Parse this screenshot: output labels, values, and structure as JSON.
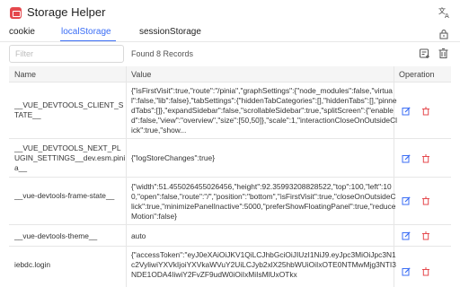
{
  "app": {
    "title": "Storage Helper"
  },
  "tabs": [
    {
      "label": "cookie"
    },
    {
      "label": "localStorage"
    },
    {
      "label": "sessionStorage"
    }
  ],
  "filter": {
    "placeholder": "Filter",
    "value": ""
  },
  "found_text": "Found 8 Records",
  "columns": {
    "name": "Name",
    "value": "Value",
    "operation": "Operation"
  },
  "rows": [
    {
      "name": "__VUE_DEVTOOLS_CLIENT_STATE__",
      "value": "{\"isFirstVisit\":true,\"route\":\"/pinia\",\"graphSettings\":{\"node_modules\":false,\"virtual\":false,\"lib\":false},\"tabSettings\":{\"hiddenTabCategories\":[],\"hiddenTabs\":[],\"pinnedTabs\":[]},\"expandSidebar\":false,\"scrollableSidebar\":true,\"splitScreen\":{\"enabled\":false,\"view\":\"overview\",\"size\":[50,50]},\"scale\":1,\"interactionCloseOnOutsideClick\":true,\"show..."
    },
    {
      "name": "__VUE_DEVTOOLS_NEXT_PLUGIN_SETTINGS__dev.esm.pinia__",
      "value": "{\"logStoreChanges\":true}"
    },
    {
      "name": "__vue-devtools-frame-state__",
      "value": "{\"width\":51.455026455026456,\"height\":92.35993208828522,\"top\":100,\"left\":100,\"open\":false,\"route\":\"/\",\"position\":\"bottom\",\"isFirstVisit\":true,\"closeOnOutsideClick\":true,\"minimizePanelInactive\":5000,\"preferShowFloatingPanel\":true,\"reduceMotion\":false}"
    },
    {
      "name": "__vue-devtools-theme__",
      "value": "auto"
    },
    {
      "name": "iebdc.login",
      "value": "{\"accessToken\":\"eyJ0eXAiOiJKV1QiLCJhbGciOiJIUzI1NiJ9.eyJpc3MiOiJpc3N1c2VyliwiYXVkIjoiYXVkaWVuY2UiLCJyb2xlX25hbWUiOiIxOTE0NTMwMjg3NTI3NDE1ODA4IiwiY2FvZF9udW0iOiIxMiIsMlUxOTkx"
    }
  ],
  "colors": {
    "accent": "#3b6ef5",
    "edit_icon": "#3b6ef5",
    "delete_icon": "#e5484d",
    "logo": "#e5484d"
  },
  "icons": {
    "logo": "storage-helper-logo-icon",
    "translate": "translate-icon",
    "lock": "lock-icon",
    "add": "add-record-icon",
    "clear": "clear-all-icon",
    "edit": "edit-icon",
    "delete": "delete-icon"
  }
}
